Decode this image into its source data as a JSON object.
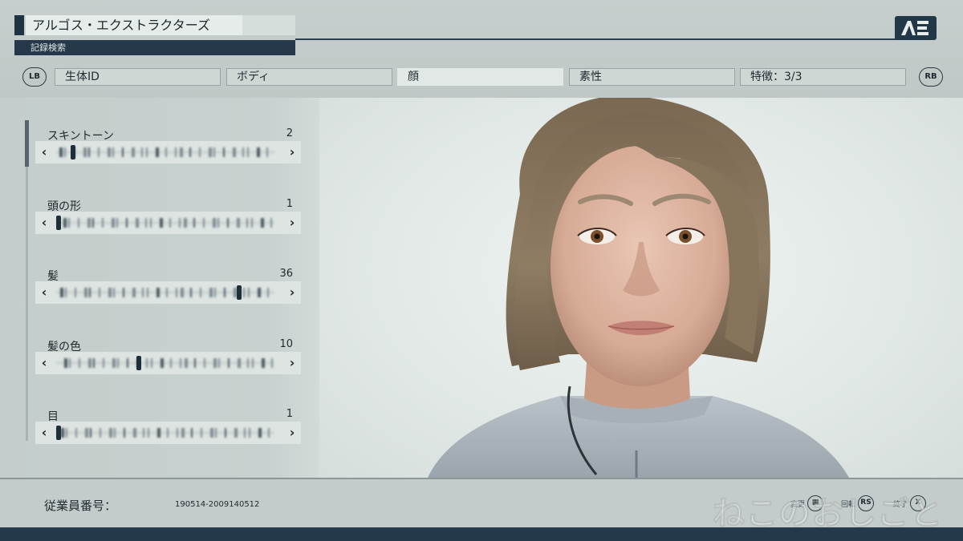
{
  "header": {
    "title": "アルゴス・エクストラクターズ",
    "subtitle": "記録検索",
    "logo_icon": "ae-logo-icon"
  },
  "tabs": {
    "left_bumper": "LB",
    "right_bumper": "RB",
    "items": [
      {
        "label": "生体ID",
        "active": false
      },
      {
        "label": "ボディ",
        "active": false
      },
      {
        "label": "顔",
        "active": true
      },
      {
        "label": "素性",
        "active": false
      },
      {
        "label": "特徴：3/3",
        "active": false
      }
    ]
  },
  "sliders": [
    {
      "label": "スキントーン",
      "value": "2",
      "position": 0.07
    },
    {
      "label": "頭の形",
      "value": "1",
      "position": 0.0
    },
    {
      "label": "髪",
      "value": "36",
      "position": 0.86
    },
    {
      "label": "髪の色",
      "value": "10",
      "position": 0.38
    },
    {
      "label": "目",
      "value": "1",
      "position": 0.0
    }
  ],
  "footer": {
    "employee_label": "従業員番号：",
    "employee_number": "190514-2009140512",
    "controls": [
      {
        "label": "変更",
        "button": "▦"
      },
      {
        "label": "回転",
        "button": "RS"
      },
      {
        "label": "終了",
        "button": "X"
      }
    ]
  },
  "watermark": "ねこのおしごと",
  "colors": {
    "accent_dark": "#24394a",
    "panel_bg": "#c4cdcb",
    "bar_bg": "#dde4e2",
    "viewport_bg": "#e6ecea"
  }
}
